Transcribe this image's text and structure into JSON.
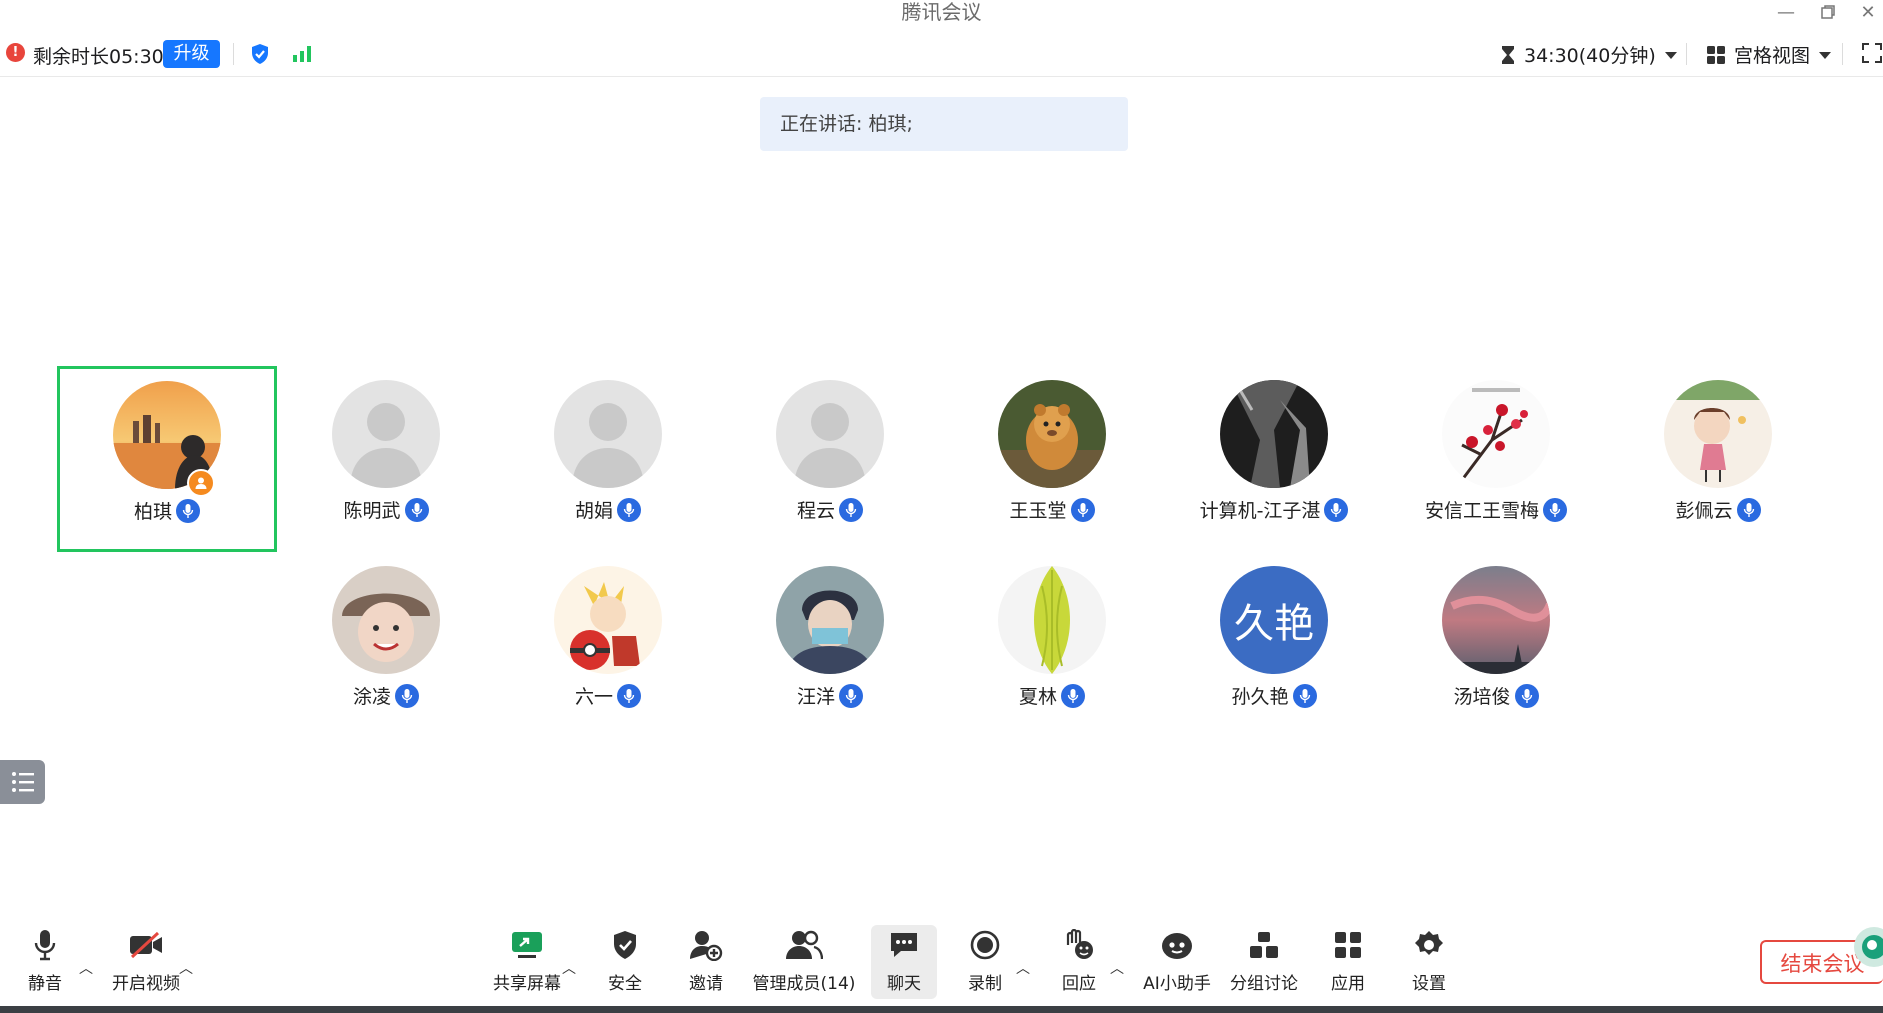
{
  "window": {
    "title": "腾讯会议"
  },
  "infobar": {
    "remaining": "剩余时长05:30",
    "upgrade_label": "升级",
    "timer": "34:30(40分钟)",
    "view_mode": "宫格视图"
  },
  "speaking": {
    "text": "正在讲话: 柏琪;"
  },
  "participants": [
    {
      "name": "柏琪"
    },
    {
      "name": "陈明武"
    },
    {
      "name": "胡娟"
    },
    {
      "name": "程云"
    },
    {
      "name": "王玉堂"
    },
    {
      "name": "计算机-江子湛"
    },
    {
      "name": "安信工王雪梅"
    },
    {
      "name": "彭佩云"
    },
    {
      "name": "涂凌"
    },
    {
      "name": "六一"
    },
    {
      "name": "汪洋"
    },
    {
      "name": "夏林"
    },
    {
      "name": "孙久艳",
      "avatar_text": "久艳"
    },
    {
      "name": "汤培俊"
    }
  ],
  "toolbar": {
    "mute": "静音",
    "video": "开启视频",
    "share": "共享屏幕",
    "security": "安全",
    "invite": "邀请",
    "members": "管理成员(14)",
    "chat": "聊天",
    "record": "录制",
    "react": "回应",
    "ai": "AI小助手",
    "breakout": "分组讨论",
    "apps": "应用",
    "settings": "设置",
    "end": "结束会议"
  },
  "colors": {
    "accent": "#1677ff",
    "active_border": "#22c55e",
    "end": "#e5483f"
  }
}
